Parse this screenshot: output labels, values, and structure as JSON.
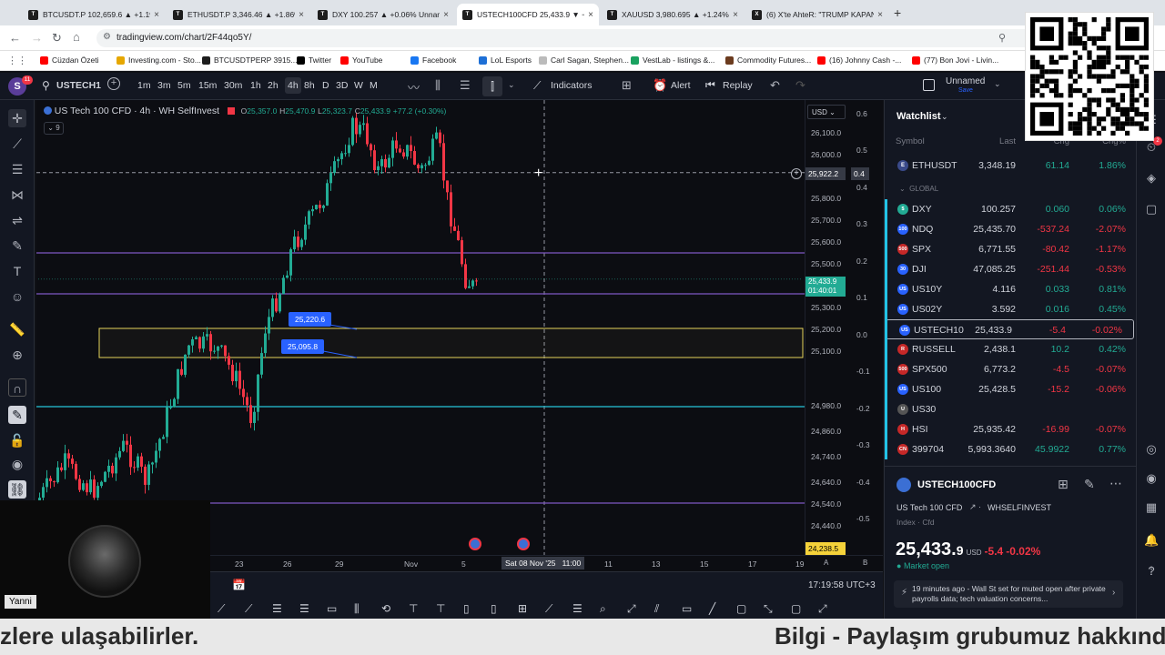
{
  "browser": {
    "tabs": [
      {
        "label": "BTCUSDT.P 102,659.6 ▲ +1.19%",
        "icon": "T",
        "color": "#1d1d1d"
      },
      {
        "label": "ETHUSDT.P 3,346.46 ▲ +1.86%",
        "icon": "T",
        "color": "#1d1d1d"
      },
      {
        "label": "DXY 100.257 ▲ +0.06% Unnam",
        "icon": "T",
        "color": "#1d1d1d"
      },
      {
        "label": "USTECH100CFD 25,433.9 ▼ −0",
        "icon": "T",
        "color": "#1d1d1d"
      },
      {
        "label": "XAUUSD 3,980.695 ▲ +1.24% U",
        "icon": "T",
        "color": "#1d1d1d"
      },
      {
        "label": "(6) X'te AhteR: \"TRUMP KAPAN",
        "icon": "X",
        "color": "#000"
      }
    ],
    "url": "tradingview.com/chart/2F44qo5Y/",
    "bookmarks": [
      "Cüzdan Özeti",
      "Investing.com - Sto...",
      "BTCUSDTPERP 3915...",
      "Twitter",
      "YouTube",
      "Facebook",
      "LoL Esports",
      "Carl Sagan, Stephen...",
      "VestLab - listings &...",
      "Commodity Futures...",
      "(16) Johnny Cash -...",
      "(77) Bon Jovi - Livin..."
    ]
  },
  "toolbar": {
    "avatar": "S",
    "badge": "11",
    "symbol": "USTECH1",
    "intervals": [
      "1m",
      "3m",
      "5m",
      "15m",
      "30m",
      "1h",
      "2h",
      "4h",
      "8h",
      "D",
      "3D",
      "W",
      "M"
    ],
    "active_interval": "4h",
    "indicators": "Indicators",
    "alert": "Alert",
    "replay": "Replay",
    "layout_name": "Unnamed",
    "layout_sub": "Save"
  },
  "chart": {
    "title": "US Tech 100 CFD · 4h · WH SelfInvest",
    "ohlc": {
      "o": "25,357.0",
      "h": "25,470.9",
      "l": "25,323.7",
      "c": "25,433.9",
      "chg": "+77.2 (+0.30%)"
    },
    "indicator_count": "9",
    "currency": "USD",
    "label_a": "25,220.6",
    "label_b": "25,095.8",
    "cursor_price": "25,922.2",
    "cursor_osc": "0.4",
    "last_price": "25,433.9",
    "last_timer": "01:40:01",
    "bottom_price": "24,238.5",
    "price_ticks": [
      "26,100.0",
      "26,000.0",
      "25,900.0",
      "25,800.0",
      "25,700.0",
      "25,600.0",
      "25,500.0",
      "25,400.0",
      "25,300.0",
      "25,200.0",
      "25,100.0",
      "24,980.0",
      "24,860.0",
      "24,740.0",
      "24,640.0",
      "24,540.0",
      "24,440.0",
      "24,350.0"
    ],
    "osc_ticks": [
      "0.6",
      "0.5",
      "0.4",
      "0.3",
      "0.2",
      "0.1",
      "0.0",
      "-0.1",
      "-0.2",
      "-0.3",
      "-0.4",
      "-0.5"
    ],
    "time_ticks": [
      "23",
      "26",
      "29",
      "Nov",
      "5",
      "11",
      "13",
      "15",
      "17",
      "19"
    ],
    "cursor_time": "Sat 08 Nov '25   11:00",
    "clock": "17:19:58 UTC+3",
    "colors": {
      "up": "#22ab94",
      "down": "#f23645",
      "purple": "#7e57c2",
      "cyan": "#26c6da",
      "yellow": "#e6d45c"
    }
  },
  "webcam": {
    "name": "Yanni"
  },
  "watchlist": {
    "title": "Watchlist",
    "columns": [
      "Symbol",
      "Last",
      "Chg",
      "Chg%"
    ],
    "top_row": {
      "sym": "ETHUSDT",
      "last": "3,348.19",
      "chg": "61.14",
      "pct": "1.86%",
      "dir": "up",
      "icon": "E",
      "icolor": "#3a4a8a"
    },
    "section": "GLOBAL",
    "rows": [
      {
        "sym": "DXY",
        "last": "100.257",
        "chg": "0.060",
        "pct": "0.06%",
        "dir": "up",
        "icon": "$",
        "icolor": "#22ab94"
      },
      {
        "sym": "NDQ",
        "last": "25,435.70",
        "chg": "-537.24",
        "pct": "-2.07%",
        "dir": "down",
        "icon": "100",
        "icolor": "#2962ff"
      },
      {
        "sym": "SPX",
        "last": "6,771.55",
        "chg": "-80.42",
        "pct": "-1.17%",
        "dir": "down",
        "icon": "500",
        "icolor": "#c62828"
      },
      {
        "sym": "DJI",
        "last": "47,085.25",
        "chg": "-251.44",
        "pct": "-0.53%",
        "dir": "down",
        "icon": "30",
        "icolor": "#2962ff"
      },
      {
        "sym": "US10Y",
        "last": "4.116",
        "chg": "0.033",
        "pct": "0.81%",
        "dir": "up",
        "icon": "US",
        "icolor": "#2962ff"
      },
      {
        "sym": "US02Y",
        "last": "3.592",
        "chg": "0.016",
        "pct": "0.45%",
        "dir": "up",
        "icon": "US",
        "icolor": "#2962ff"
      },
      {
        "sym": "USTECH10",
        "last": "25,433.9",
        "chg": "-5.4",
        "pct": "-0.02%",
        "dir": "down",
        "icon": "US",
        "icolor": "#2962ff"
      },
      {
        "sym": "RUSSELL",
        "last": "2,438.1",
        "chg": "10.2",
        "pct": "0.42%",
        "dir": "up",
        "icon": "R",
        "icolor": "#c62828"
      },
      {
        "sym": "SPX500",
        "last": "6,773.2",
        "chg": "-4.5",
        "pct": "-0.07%",
        "dir": "down",
        "icon": "500",
        "icolor": "#c62828"
      },
      {
        "sym": "US100",
        "last": "25,428.5",
        "chg": "-15.2",
        "pct": "-0.06%",
        "dir": "down",
        "icon": "US",
        "icolor": "#2962ff"
      },
      {
        "sym": "US30",
        "last": "",
        "chg": "",
        "pct": "",
        "dir": "down",
        "icon": "U",
        "icolor": "#555"
      },
      {
        "sym": "HSI",
        "last": "25,935.42",
        "chg": "-16.99",
        "pct": "-0.07%",
        "dir": "down",
        "icon": "H",
        "icolor": "#c62828"
      },
      {
        "sym": "399704",
        "last": "5,993.3640",
        "chg": "45.9922",
        "pct": "0.77%",
        "dir": "up",
        "icon": "CN",
        "icolor": "#c62828"
      }
    ]
  },
  "detail": {
    "symbol": "USTECH100CFD",
    "name": "US Tech 100 CFD",
    "exchange": "WHSELFINVEST",
    "type": "Index · Cfd",
    "price_main": "25,433.",
    "price_tail": "9",
    "currency": "USD",
    "change": "-5.4",
    "change_pct": "-0.02%",
    "status": "Market open",
    "news_time": "19 minutes ago",
    "news_text": "Wall St set for muted open after private payrolls data; tech valuation concerns..."
  },
  "ticker": {
    "left": "zlere ulaşabilirler.",
    "right": "Bilgi - Paylaşım grubumuz hakkında"
  }
}
